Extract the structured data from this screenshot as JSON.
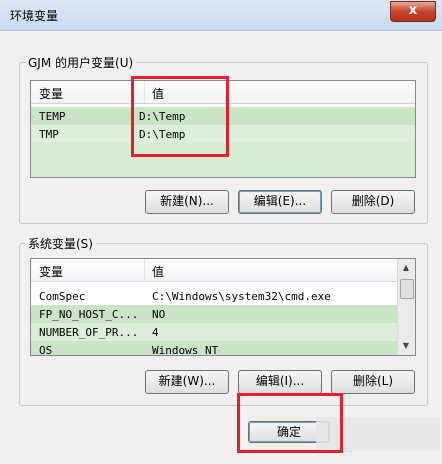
{
  "window": {
    "title": "环境变量",
    "close_glyph": "x"
  },
  "user_vars": {
    "group_label": "GJM 的用户变量(U)",
    "columns": [
      "变量",
      "值"
    ],
    "rows": [
      {
        "name": "TEMP",
        "value": "D:\\Temp"
      },
      {
        "name": "TMP",
        "value": "D:\\Temp"
      }
    ],
    "buttons": {
      "new": "新建(N)...",
      "edit": "编辑(E)...",
      "delete": "删除(D)"
    }
  },
  "system_vars": {
    "group_label": "系统变量(S)",
    "columns": [
      "变量",
      "值"
    ],
    "rows": [
      {
        "name": "ComSpec",
        "value": "C:\\Windows\\system32\\cmd.exe"
      },
      {
        "name": "FP_NO_HOST_C...",
        "value": "NO"
      },
      {
        "name": "NUMBER_OF_PR...",
        "value": "4"
      },
      {
        "name": "OS",
        "value": "Windows_NT"
      }
    ],
    "buttons": {
      "new": "新建(W)...",
      "edit": "编辑(I)...",
      "delete": "删除(L)"
    }
  },
  "footer": {
    "ok_label": "确定"
  },
  "colors": {
    "highlight_red": "#e5202a",
    "row_green": "#c9e5c6",
    "row_green_light": "#dcefd8"
  },
  "icons": {
    "scroll_up": "up-arrow-icon",
    "scroll_down": "down-arrow-icon"
  }
}
